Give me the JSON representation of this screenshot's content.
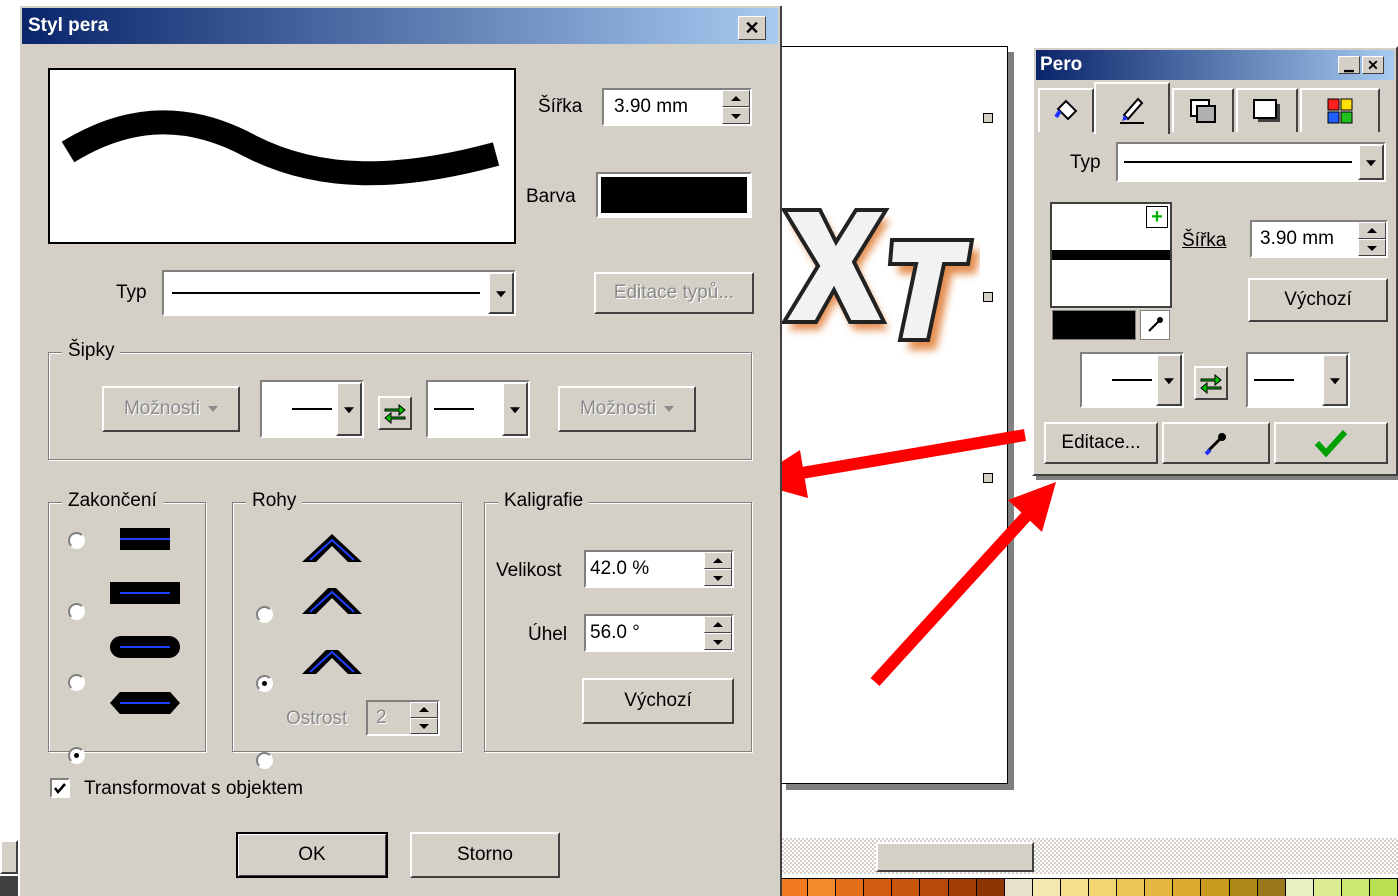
{
  "dialog": {
    "title": "Styl pera",
    "width_label": "Šířka",
    "width_value": "3.90 mm",
    "color_label": "Barva",
    "color_value": "#000000",
    "type_label": "Typ",
    "edit_types_button": "Editace typů...",
    "arrows": {
      "legend": "Šipky",
      "options_left": "Možnosti",
      "options_right": "Možnosti"
    },
    "caps": {
      "legend": "Zakončení",
      "selected_index": 3
    },
    "corners": {
      "legend": "Rohy",
      "selected_index": 1,
      "sharpness_label": "Ostrost",
      "sharpness_value": "2"
    },
    "calligraphy": {
      "legend": "Kaligrafie",
      "size_label": "Velikost",
      "size_value": "42.0 %",
      "angle_label": "Úhel",
      "angle_value": "56.0 °",
      "default_button": "Výchozí"
    },
    "transform_checkbox": "Transformovat s objektem",
    "transform_checked": true,
    "ok_button": "OK",
    "cancel_button": "Storno"
  },
  "panel": {
    "title": "Pero",
    "type_label": "Typ",
    "width_label": "Šířka",
    "width_value": "3.90 mm",
    "default_button": "Výchozí",
    "edit_button": "Editace...",
    "tabs": [
      "fill-icon",
      "pen-icon",
      "transparency-icon",
      "shadow-icon",
      "palette-icon"
    ]
  },
  "colors": {
    "title_start": "#0a246a",
    "title_end": "#a6caf0",
    "face": "#d4d0c8",
    "arrow": "#ff0000",
    "accent_blue": "#0000ff"
  },
  "palette_colors": [
    "#f47a20",
    "#f18a2a",
    "#e56e18",
    "#d45c10",
    "#c8560c",
    "#b8490a",
    "#a33e08",
    "#8e3506",
    "#e8e0c8",
    "#f3e8b0",
    "#f5e08c",
    "#f2d470",
    "#ecc654",
    "#e4b840",
    "#dcaa30",
    "#c89a20",
    "#b08a18",
    "#98781a",
    "#e8f0c0",
    "#dcec90",
    "#cce870",
    "#b8e050"
  ]
}
